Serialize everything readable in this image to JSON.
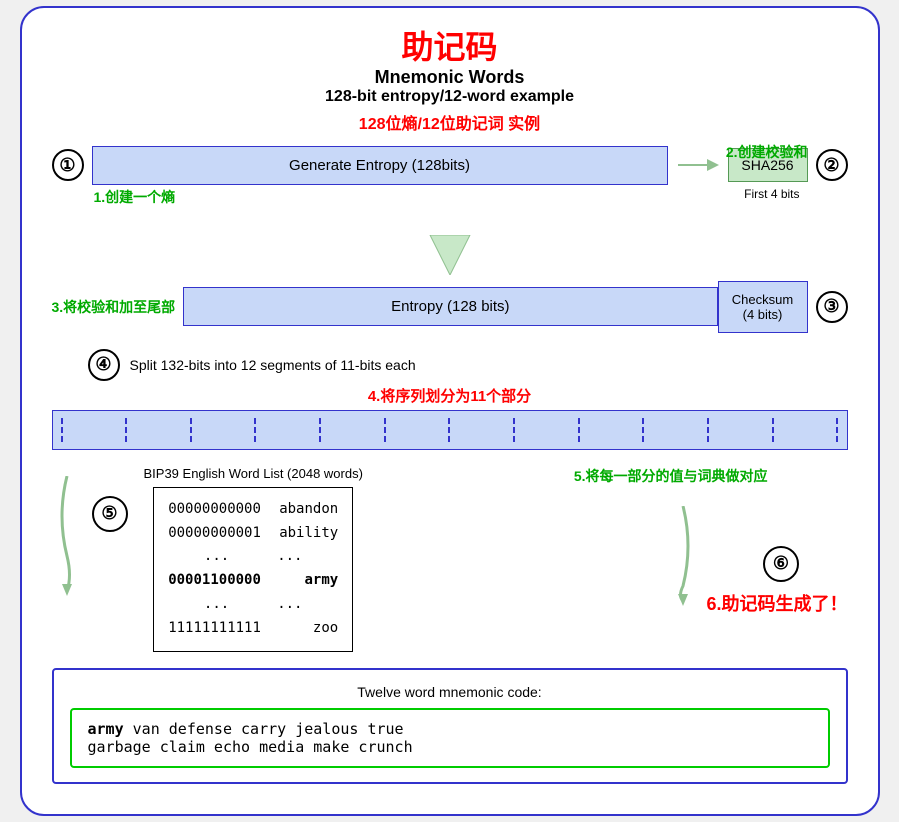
{
  "title": {
    "zh": "助记码",
    "en1": "Mnemonic Words",
    "en2": "128-bit entropy/12-word example",
    "zh2": "128位熵/12位助记词 实例"
  },
  "step2_label": "2.创建校验和",
  "step1": {
    "circle": "①",
    "label": "Generate Entropy (128bits)",
    "sublabel": "1.创建一个熵",
    "sha_label": "SHA256",
    "firstbits": "First 4 bits",
    "circle2": "②"
  },
  "step3": {
    "label": "3.将校验和加至尾部",
    "entropy": "Entropy (128 bits)",
    "checksum": "Checksum\n(4 bits)",
    "circle": "③"
  },
  "step4": {
    "circle": "④",
    "text": "Split 132-bits into 12 segments of 11-bits each",
    "label_zh": "4.将序列划分为11个部分"
  },
  "step5": {
    "circle": "⑤",
    "wordlist_title": "BIP39 English Word List (2048 words)",
    "words": [
      {
        "binary": "00000000000",
        "word": "abandon"
      },
      {
        "binary": "00000000001",
        "word": "ability"
      },
      {
        "binary": "...",
        "word": "..."
      },
      {
        "binary": "00001100000",
        "word": "army",
        "bold": true
      },
      {
        "binary": "...",
        "word": "..."
      },
      {
        "binary": "11111111111",
        "word": "zoo"
      }
    ],
    "label": "5.将每一部分的值与词典做对应"
  },
  "step6": {
    "circle": "⑥",
    "label": "6.助记码生成了！",
    "mnemonic_title": "Twelve word mnemonic code:",
    "words_line1": "army van defense carry jealous true",
    "words_line2": "garbage claim echo media make crunch",
    "army_bold": "army"
  }
}
